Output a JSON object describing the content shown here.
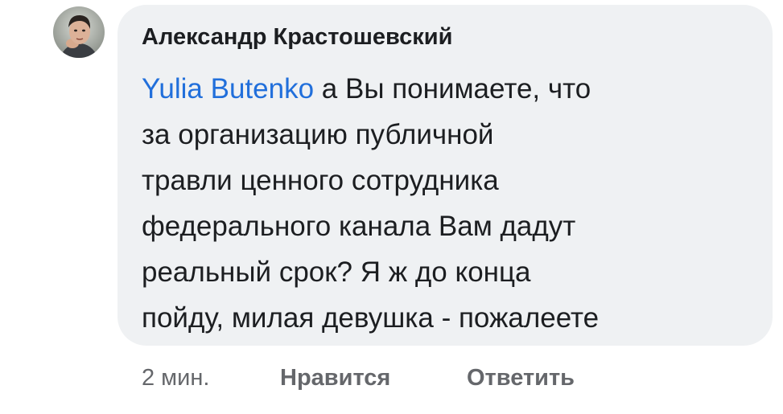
{
  "comment": {
    "author": "Александр Крастошевский",
    "mention": "Yulia Butenko",
    "lines": [
      " а Вы понимаете, что",
      "за организацию публичной",
      "травли ценного сотрудника",
      "федерального канала Вам дадут",
      "реальный срок? Я ж до конца",
      "пойду, милая девушка - пожалеете"
    ],
    "avatar": "user-avatar-photo"
  },
  "actions": {
    "time": "2 мин.",
    "like_label": "Нравится",
    "reply_label": "Ответить"
  },
  "colors": {
    "bubble": "#eff1f3",
    "text": "#1c1e21",
    "mention": "#216fdb",
    "meta": "#65676b"
  }
}
